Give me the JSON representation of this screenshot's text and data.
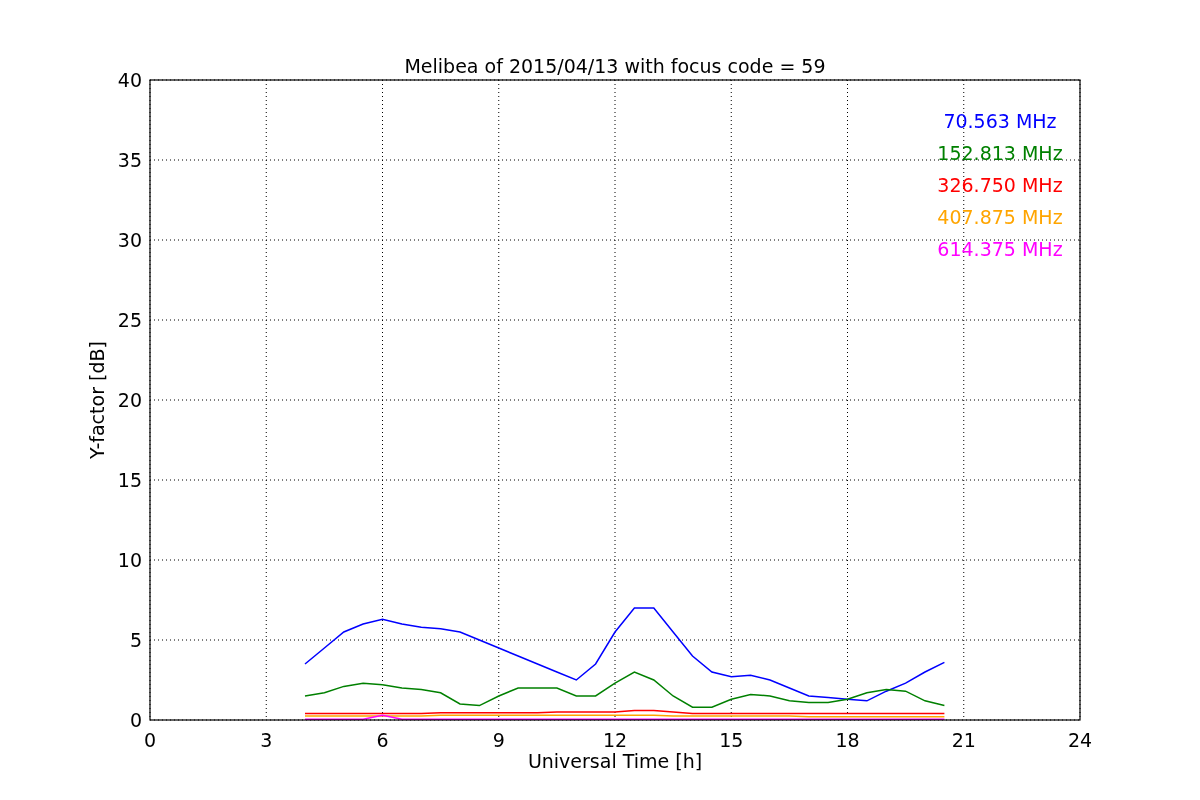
{
  "chart_data": {
    "type": "line",
    "title": "Melibea of 2015/04/13 with focus code = 59",
    "xlabel": "Universal Time [h]",
    "ylabel": "Y-factor [dB]",
    "x": [
      4,
      4.5,
      5,
      5.5,
      6,
      6.5,
      7,
      7.5,
      8,
      8.5,
      9,
      9.5,
      10,
      10.5,
      11,
      11.5,
      12,
      12.5,
      13,
      13.5,
      14,
      14.5,
      15,
      15.5,
      16,
      16.5,
      17,
      17.5,
      18,
      18.5,
      19,
      19.5,
      20,
      20.5
    ],
    "series": [
      {
        "name": "70.563 MHz",
        "color": "#0000ff",
        "values": [
          3.5,
          4.5,
          5.5,
          6.0,
          6.3,
          6.0,
          5.8,
          5.7,
          5.5,
          5.0,
          4.5,
          4.0,
          3.5,
          3.0,
          2.5,
          3.5,
          5.5,
          7.0,
          7.0,
          5.5,
          4.0,
          3.0,
          2.7,
          2.8,
          2.5,
          2.0,
          1.5,
          1.4,
          1.3,
          1.2,
          1.8,
          2.3,
          3.0,
          3.6
        ]
      },
      {
        "name": "152.813 MHz",
        "color": "#008000",
        "values": [
          1.5,
          1.7,
          2.1,
          2.3,
          2.2,
          2.0,
          1.9,
          1.7,
          1.0,
          0.9,
          1.5,
          2.0,
          2.0,
          2.0,
          1.5,
          1.5,
          2.3,
          3.0,
          2.5,
          1.5,
          0.8,
          0.8,
          1.3,
          1.6,
          1.5,
          1.2,
          1.1,
          1.1,
          1.3,
          1.7,
          1.9,
          1.8,
          1.2,
          0.9
        ]
      },
      {
        "name": "326.750 MHz",
        "color": "#ff0000",
        "values": [
          0.4,
          0.4,
          0.4,
          0.4,
          0.4,
          0.4,
          0.4,
          0.45,
          0.45,
          0.45,
          0.45,
          0.45,
          0.45,
          0.5,
          0.5,
          0.5,
          0.5,
          0.6,
          0.6,
          0.5,
          0.4,
          0.4,
          0.4,
          0.4,
          0.4,
          0.4,
          0.4,
          0.4,
          0.4,
          0.4,
          0.4,
          0.4,
          0.4,
          0.4
        ]
      },
      {
        "name": "407.875 MHz",
        "color": "#ffa500",
        "values": [
          0.25,
          0.25,
          0.25,
          0.25,
          0.25,
          0.25,
          0.25,
          0.3,
          0.3,
          0.3,
          0.3,
          0.3,
          0.3,
          0.3,
          0.3,
          0.3,
          0.3,
          0.3,
          0.3,
          0.25,
          0.25,
          0.25,
          0.25,
          0.25,
          0.25,
          0.25,
          0.2,
          0.2,
          0.2,
          0.2,
          0.2,
          0.2,
          0.2,
          0.2
        ]
      },
      {
        "name": "614.375 MHz",
        "color": "#ff00ff",
        "values": [
          0.05,
          0.05,
          0.05,
          0.05,
          0.3,
          0.05,
          0.05,
          0.05,
          0.05,
          0.05,
          0.05,
          0.05,
          0.05,
          0.05,
          0.05,
          0.05,
          0.05,
          0.05,
          0.05,
          0.05,
          0.05,
          0.05,
          0.05,
          0.05,
          0.05,
          0.05,
          0.05,
          0.05,
          0.05,
          0.05,
          0.05,
          0.05,
          0.05,
          0.05
        ]
      }
    ],
    "grid": true,
    "xlim": [
      0,
      24
    ],
    "ylim": [
      0,
      40
    ],
    "xticks": [
      0,
      3,
      6,
      9,
      12,
      15,
      18,
      21,
      24
    ],
    "yticks": [
      0,
      5,
      10,
      15,
      20,
      25,
      30,
      35,
      40
    ]
  }
}
